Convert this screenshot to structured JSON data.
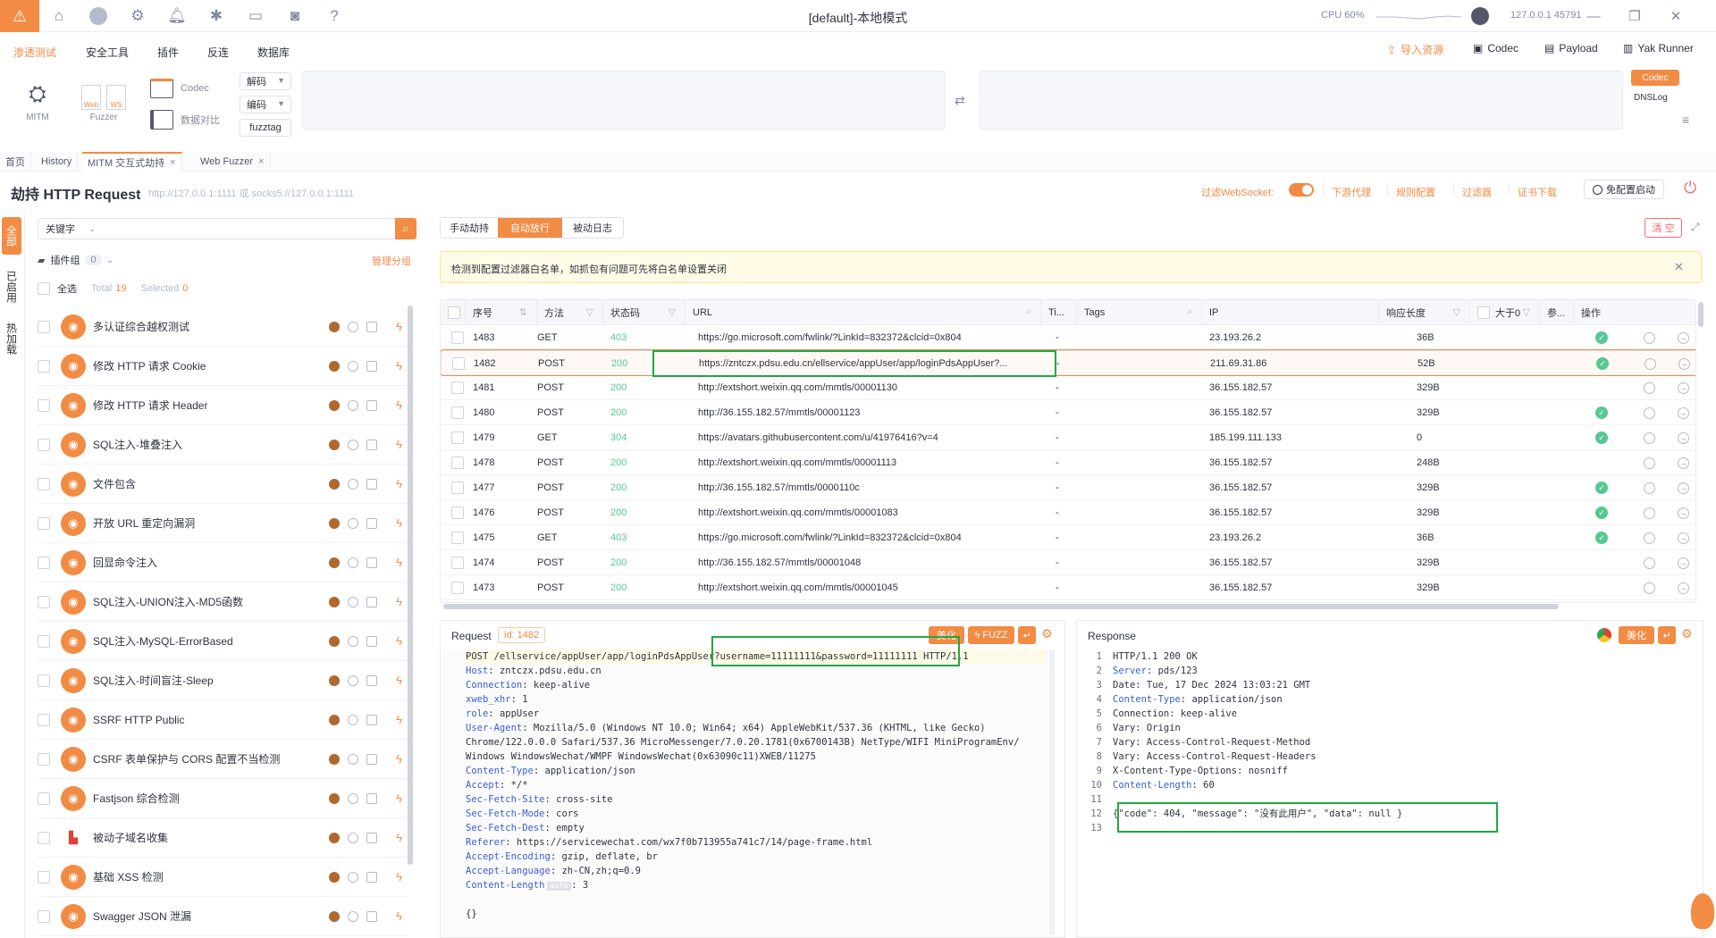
{
  "window": {
    "title": "[default]-本地模式",
    "cpu": "CPU 60%",
    "ip": "127.0.0.1 45791"
  },
  "menu": {
    "items": [
      "渗透测试",
      "安全工具",
      "插件",
      "反连",
      "数据库"
    ],
    "right": [
      "导入资源",
      "Codec",
      "Payload",
      "Yak Runner"
    ]
  },
  "toolbar": {
    "mitm": "MITM",
    "fuzzer": "Fuzzer",
    "web": "Web",
    "ws": "WS",
    "codec": "Codec",
    "compare": "数据对比",
    "decode": "解码",
    "encode": "编码",
    "fuzztag": "fuzztag",
    "codec_btn": "Codec",
    "dnslog": "DNSLog"
  },
  "tabs": [
    {
      "label": "首页"
    },
    {
      "label": "History"
    },
    {
      "label": "MITM 交互式劫持"
    },
    {
      "label": "Web Fuzzer"
    }
  ],
  "header": {
    "title": "劫持 HTTP Request",
    "subtitle": "http://127.0.0.1:1111 或 socks5://127.0.0.1:1111",
    "filter_ws": "过滤WebSocket:",
    "links": [
      "下游代理",
      "规则配置",
      "过滤器",
      "证书下载"
    ],
    "free_cfg": "免配置启动"
  },
  "left": {
    "vtabs": [
      "全部",
      "已启用",
      "热加载"
    ],
    "search_type": "关键字",
    "plugin_group": "插件组",
    "plugin_group_count": "0",
    "manage_group": "管理分组",
    "select_all": "全选",
    "total_label": "Total",
    "total": "19",
    "selected_label": "Selected",
    "selected": "0",
    "plugins": [
      "多认证综合越权测试",
      "修改 HTTP 请求 Cookie",
      "修改 HTTP 请求 Header",
      "SQL注入-堆叠注入",
      "文件包含",
      "开放 URL 重定向漏洞",
      "回显命令注入",
      "SQL注入-UNION注入-MD5函数",
      "SQL注入-MySQL-ErrorBased",
      "SQL注入-时间盲注-Sleep",
      "SSRF HTTP Public",
      "CSRF 表单保护与 CORS 配置不当检测",
      "Fastjson 综合检测",
      "被动子域名收集",
      "基础 XSS 检测",
      "Swagger JSON 泄漏"
    ]
  },
  "main": {
    "mode_tabs": [
      "手动劫持",
      "自动放行",
      "被动日志"
    ],
    "clear": "清 空",
    "notice": "检测到配置过滤器白名单，如抓包有问题可先将白名单设置关闭",
    "columns": [
      "序号",
      "方法",
      "状态码",
      "URL",
      "Ti...",
      "Tags",
      "IP",
      "响应长度",
      "大于0",
      "参...",
      "操作"
    ],
    "rows": [
      {
        "id": "1483",
        "method": "GET",
        "status": "403",
        "url": "https://go.microsoft.com/fwlink/?LinkId=832372&clcid=0x804",
        "ti": "-",
        "ip": "23.193.26.2",
        "len": "36B",
        "param": true
      },
      {
        "id": "1482",
        "method": "POST",
        "status": "200",
        "url": "https://zntczx.pdsu.edu.cn/ellservice/appUser/app/loginPdsAppUser?...",
        "ti": "-",
        "ip": "211.69.31.86",
        "len": "52B",
        "param": true
      },
      {
        "id": "1481",
        "method": "POST",
        "status": "200",
        "url": "http://extshort.weixin.qq.com/mmtls/00001130",
        "ti": "-",
        "ip": "36.155.182.57",
        "len": "329B",
        "param": false
      },
      {
        "id": "1480",
        "method": "POST",
        "status": "200",
        "url": "http://36.155.182.57/mmtls/00001123",
        "ti": "-",
        "ip": "36.155.182.57",
        "len": "329B",
        "param": true
      },
      {
        "id": "1479",
        "method": "GET",
        "status": "304",
        "url": "https://avatars.githubusercontent.com/u/41976416?v=4",
        "ti": "-",
        "ip": "185.199.111.133",
        "len": "0",
        "param": true
      },
      {
        "id": "1478",
        "method": "POST",
        "status": "200",
        "url": "http://extshort.weixin.qq.com/mmtls/00001113",
        "ti": "-",
        "ip": "36.155.182.57",
        "len": "248B",
        "param": false
      },
      {
        "id": "1477",
        "method": "POST",
        "status": "200",
        "url": "http://36.155.182.57/mmtls/0000110c",
        "ti": "-",
        "ip": "36.155.182.57",
        "len": "329B",
        "param": true
      },
      {
        "id": "1476",
        "method": "POST",
        "status": "200",
        "url": "http://extshort.weixin.qq.com/mmtls/00001083",
        "ti": "-",
        "ip": "36.155.182.57",
        "len": "329B",
        "param": true
      },
      {
        "id": "1475",
        "method": "GET",
        "status": "403",
        "url": "https://go.microsoft.com/fwlink/?LinkId=832372&clcid=0x804",
        "ti": "-",
        "ip": "23.193.26.2",
        "len": "36B",
        "param": true
      },
      {
        "id": "1474",
        "method": "POST",
        "status": "200",
        "url": "http://36.155.182.57/mmtls/00001048",
        "ti": "-",
        "ip": "36.155.182.57",
        "len": "329B",
        "param": false
      },
      {
        "id": "1473",
        "method": "POST",
        "status": "200",
        "url": "http://extshort.weixin.qq.com/mmtls/00001045",
        "ti": "-",
        "ip": "36.155.182.57",
        "len": "329B",
        "param": false
      }
    ]
  },
  "request": {
    "title": "Request",
    "id_badge": "id: 1482",
    "beautify": "美化",
    "fuzz": "FUZZ",
    "lines": [
      [
        "",
        "POST /ellservice/appUser/app/loginPdsAppUser?username=11111111&password=11111111 HTTP/1.1"
      ],
      [
        "Host",
        "zntczx.pdsu.edu.cn"
      ],
      [
        "Connection",
        "keep-alive"
      ],
      [
        "xweb_xhr",
        "1"
      ],
      [
        "role",
        "appUser"
      ],
      [
        "User-Agent",
        "Mozilla/5.0 (Windows NT 10.0; Win64; x64) AppleWebKit/537.36 (KHTML, like Gecko)"
      ],
      [
        "",
        "Chrome/122.0.0.0 Safari/537.36 MicroMessenger/7.0.20.1781(0x6700143B) NetType/WIFI MiniProgramEnv/"
      ],
      [
        "",
        "Windows WindowsWechat/WMPF WindowsWechat(0x63090c11)XWEB/11275"
      ],
      [
        "Content-Type",
        "application/json"
      ],
      [
        "Accept",
        "*/*"
      ],
      [
        "Sec-Fetch-Site",
        "cross-site"
      ],
      [
        "Sec-Fetch-Mode",
        "cors"
      ],
      [
        "Sec-Fetch-Dest",
        "empty"
      ],
      [
        "Referer",
        "https://servicewechat.com/wx7f0b713955a741c7/14/page-frame.html"
      ],
      [
        "Accept-Encoding",
        "gzip, deflate, br"
      ],
      [
        "Accept-Language",
        "zh-CN,zh;q=0.9"
      ],
      [
        "Content-Length",
        "3"
      ],
      [
        "",
        ""
      ],
      [
        "",
        "{}"
      ]
    ],
    "auto_badge": "auto"
  },
  "response": {
    "title": "Response",
    "beautify": "美化",
    "lines": [
      [
        "",
        "HTTP/1.1 200 OK"
      ],
      [
        "Server",
        "pds/123"
      ],
      [
        "",
        "Date: Tue, 17 Dec 2024 13:03:21 GMT"
      ],
      [
        "Content-Type",
        "application/json"
      ],
      [
        "",
        "Connection: keep-alive"
      ],
      [
        "",
        "Vary: Origin"
      ],
      [
        "",
        "Vary: Access-Control-Request-Method"
      ],
      [
        "",
        "Vary: Access-Control-Request-Headers"
      ],
      [
        "",
        "X-Content-Type-Options: nosniff"
      ],
      [
        "Content-Length",
        "60"
      ],
      [
        "",
        ""
      ],
      [
        "",
        "{\"code\": 404, \"message\": \"没有此用户\", \"data\": null }"
      ],
      [
        "",
        ""
      ]
    ]
  }
}
